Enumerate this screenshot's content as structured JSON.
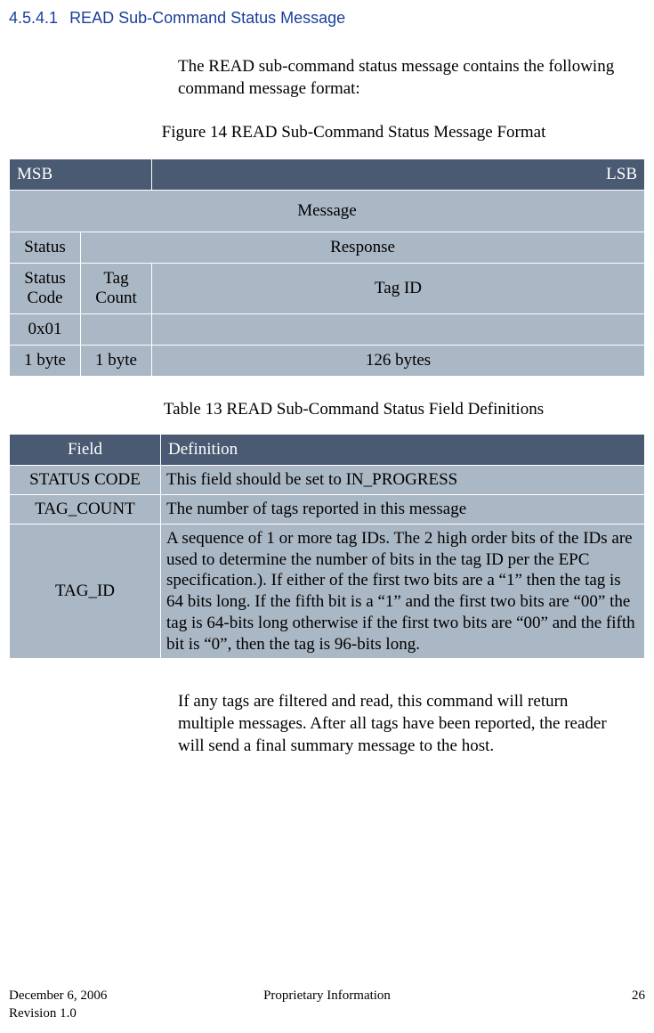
{
  "section": {
    "number": "4.5.4.1",
    "title": "READ Sub-Command Status Message"
  },
  "intro": "The READ sub-command status message contains the following command message format:",
  "figure_caption": "Figure 14 READ Sub-Command Status Message Format",
  "format_table": {
    "msb": "MSB",
    "lsb": "LSB",
    "message": "Message",
    "status": "Status",
    "response": "Response",
    "status_code": "Status Code",
    "tag_count": "Tag Count",
    "tag_id": "Tag ID",
    "val_status": "0x01",
    "sz_col1": "1 byte",
    "sz_col2": "1 byte",
    "sz_col3": "126 bytes"
  },
  "table_caption": "Table 13 READ Sub-Command Status Field Definitions",
  "def_table": {
    "hdr_field": "Field",
    "hdr_def": "Definition",
    "rows": [
      {
        "field": "STATUS CODE",
        "def": "This field should be set to IN_PROGRESS"
      },
      {
        "field": "TAG_COUNT",
        "def": "The number of tags reported in this message"
      },
      {
        "field": "TAG_ID",
        "def": "A sequence of 1 or more tag IDs.  The 2 high order bits of the IDs are used to determine the number of bits in the tag ID per the EPC specification.).  If either of the first two bits are a “1” then the tag is 64 bits long.  If the fifth bit is a “1” and the first two bits are “00” the tag is 64-bits long otherwise if the first two bits are “00” and the fifth bit is “0”, then the tag is 96-bits long."
      }
    ]
  },
  "outro": "If any tags are filtered and read, this command will return multiple messages.  After all tags have been reported, the reader will send a final summary message to the host.",
  "footer": {
    "date": "December 6, 2006",
    "revision": "Revision 1.0",
    "center": "Proprietary Information",
    "page": "26"
  }
}
